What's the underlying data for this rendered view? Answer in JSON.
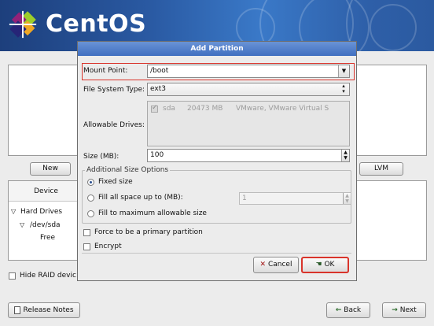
{
  "banner": {
    "brand": "CentOS"
  },
  "background": {
    "buttons": {
      "new": "New",
      "lvm": "LVM",
      "release_notes": "Release Notes",
      "back": "Back",
      "next": "Next"
    },
    "device_header": "Device",
    "tree": {
      "hard_drives": "Hard Drives",
      "dev_sda": "/dev/sda",
      "free": "Free"
    },
    "hide_raid": "Hide RAID devic"
  },
  "dialog": {
    "title": "Add Partition",
    "mount_point_label": "Mount Point:",
    "mount_point_value": "/boot",
    "fs_type_label": "File System Type:",
    "fs_type_value": "ext3",
    "allowable_drives_label": "Allowable Drives:",
    "drives": [
      {
        "name": "sda",
        "size": "20473 MB",
        "model": "VMware, VMware Virtual S",
        "checked": true
      }
    ],
    "size_label": "Size (MB):",
    "size_value": "100",
    "size_options_title": "Additional Size Options",
    "opt_fixed": "Fixed size",
    "opt_fill_upto": "Fill all space up to (MB):",
    "fill_upto_value": "1",
    "opt_fill_max": "Fill to maximum allowable size",
    "selected_option": "fixed",
    "force_primary": "Force to be a primary partition",
    "encrypt": "Encrypt",
    "cancel": "Cancel",
    "ok": "OK"
  },
  "colors": {
    "highlight_border": "#d9342b",
    "title_bar": "#4a78c7"
  }
}
